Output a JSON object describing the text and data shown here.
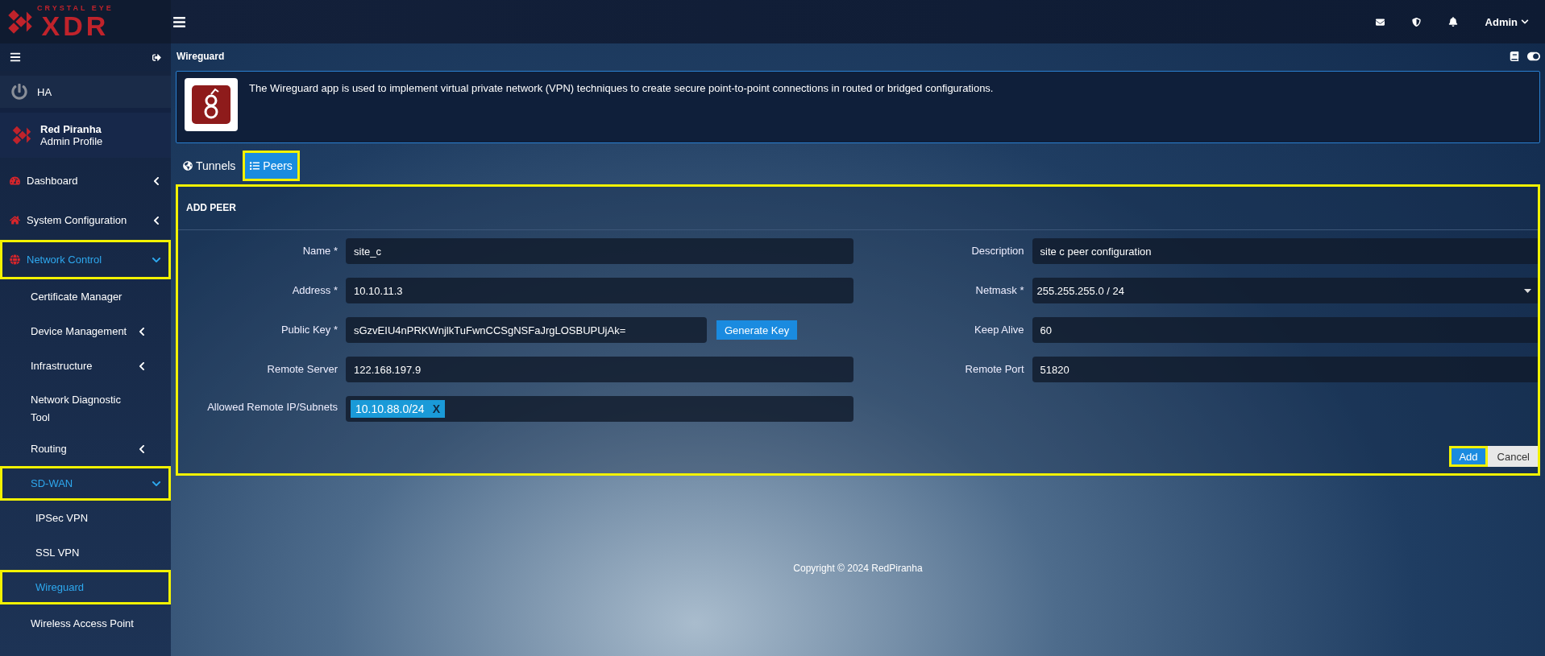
{
  "logo": {
    "top": "CRYSTAL EYE",
    "main": "XDR"
  },
  "header": {
    "user": "Admin"
  },
  "sidebar": {
    "ha": "HA",
    "profile": {
      "name": "Red Piranha",
      "role": "Admin Profile"
    },
    "items": [
      {
        "label": "Dashboard",
        "expanded": false,
        "selected": false,
        "highlighted": false
      },
      {
        "label": "System Configuration",
        "expanded": false,
        "selected": false,
        "highlighted": false
      },
      {
        "label": "Network Control",
        "expanded": true,
        "selected": true,
        "highlighted": true,
        "children": [
          {
            "label": "Certificate Manager",
            "selected": false,
            "highlighted": false
          },
          {
            "label": "Device Management",
            "expanded": false,
            "selected": false,
            "highlighted": false
          },
          {
            "label": "Infrastructure",
            "expanded": false,
            "selected": false,
            "highlighted": false
          },
          {
            "label": "Network Diagnostic Tool",
            "selected": false,
            "highlighted": false
          },
          {
            "label": "Routing",
            "expanded": false,
            "selected": false,
            "highlighted": false
          },
          {
            "label": "SD-WAN",
            "expanded": true,
            "selected": true,
            "highlighted": true,
            "children": [
              {
                "label": "IPSec VPN",
                "selected": false,
                "highlighted": false
              },
              {
                "label": "SSL VPN",
                "selected": false,
                "highlighted": false
              },
              {
                "label": "Wireguard",
                "selected": true,
                "highlighted": true
              }
            ]
          },
          {
            "label": "Wireless Access Point",
            "selected": false,
            "highlighted": false
          }
        ]
      }
    ]
  },
  "page_title": "Wireguard",
  "banner": "The Wireguard app is used to implement virtual private network (VPN) techniques to create secure point-to-point connections in routed or bridged configurations.",
  "tabs": [
    {
      "label": "Tunnels",
      "selected": false,
      "highlighted": false
    },
    {
      "label": "Peers",
      "selected": true,
      "highlighted": true
    }
  ],
  "form": {
    "title": "ADD PEER",
    "highlighted": true,
    "left_fields": [
      {
        "label": "Name *",
        "kind": "text",
        "value": "site_c"
      },
      {
        "label": "Address *",
        "kind": "text",
        "value": "10.10.11.3"
      },
      {
        "label": "Public Key *",
        "kind": "key",
        "value": "sGzvEIU4nPRKWnjlkTuFwnCCSgNSFaJrgLOSBUPUjAk=",
        "action": "Generate Key"
      },
      {
        "label": "Remote Server",
        "kind": "text",
        "value": "122.168.197.9"
      },
      {
        "label": "Allowed Remote IP/Subnets",
        "kind": "tags",
        "tags": [
          {
            "label": "10.10.88.0/24",
            "remove": "X"
          }
        ]
      }
    ],
    "right_fields": [
      {
        "label": "Description",
        "kind": "text",
        "value": "site c peer configuration"
      },
      {
        "label": "Netmask *",
        "kind": "select",
        "value": "255.255.255.0 / 24"
      },
      {
        "label": "Keep Alive",
        "kind": "text",
        "value": "60"
      },
      {
        "label": "Remote Port",
        "kind": "text",
        "value": "51820"
      }
    ],
    "buttons": [
      {
        "label": "Add",
        "kind": "primary",
        "highlighted": true
      },
      {
        "label": "Cancel",
        "kind": "secondary",
        "highlighted": false
      }
    ]
  },
  "copyright": "Copyright © 2024 RedPiranha"
}
